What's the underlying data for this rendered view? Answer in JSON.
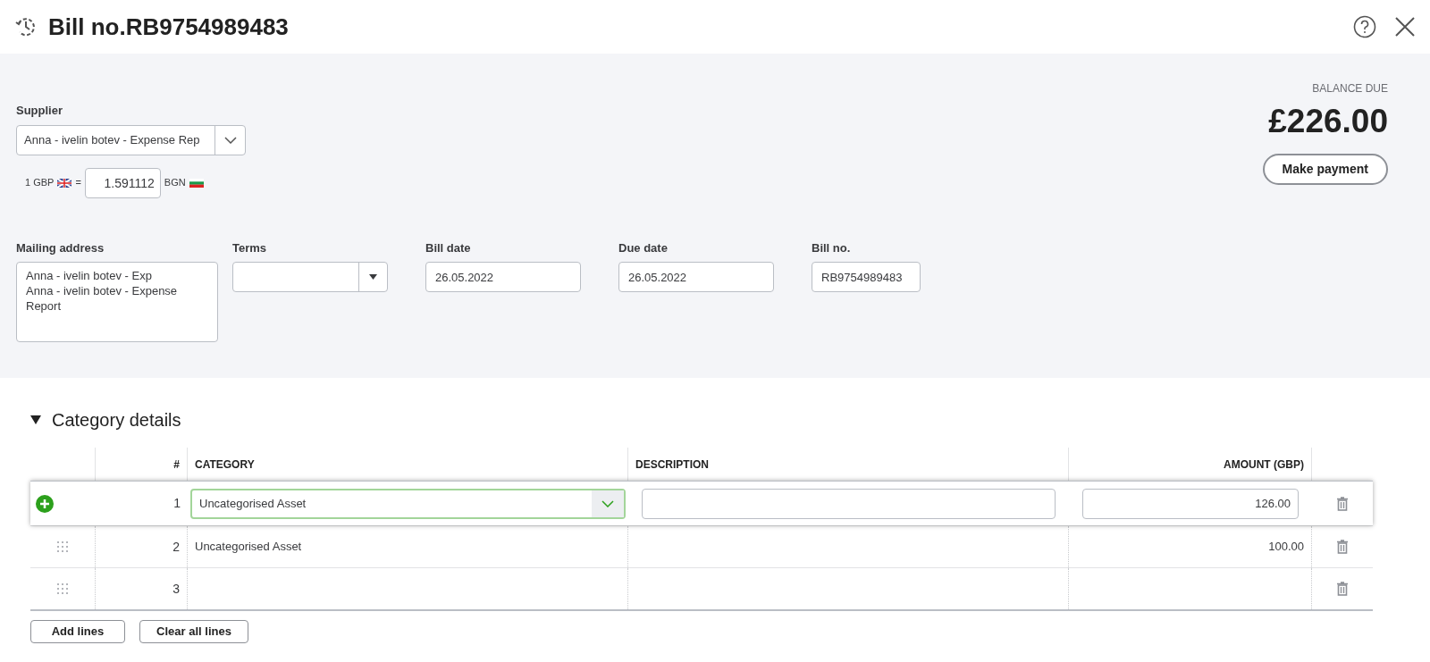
{
  "header": {
    "title": "Bill no.RB9754989483"
  },
  "balance": {
    "label": "BALANCE DUE",
    "amount": "£226.00",
    "button": "Make payment"
  },
  "supplier": {
    "label": "Supplier",
    "value": "Anna - ivelin botev - Expense Rep"
  },
  "exchange": {
    "base": "1 GBP",
    "equals": "=",
    "rate": "1.591112",
    "quote": "BGN"
  },
  "fields": [
    {
      "kind": "textarea",
      "label": "Mailing address",
      "value": "Anna - ivelin botev - Exp\nAnna - ivelin botev - Expense Report"
    },
    {
      "kind": "select",
      "label": "Terms"
    },
    {
      "kind": "text",
      "label": "Bill date",
      "value": "26.05.2022"
    },
    {
      "kind": "text",
      "label": "Due date",
      "value": "26.05.2022"
    },
    {
      "kind": "text",
      "label": "Bill no.",
      "value": "RB9754989483"
    }
  ],
  "category_section": {
    "title": "Category details",
    "expanded": true,
    "columns": [
      "#",
      "CATEGORY",
      "DESCRIPTION",
      "AMOUNT (GBP)"
    ],
    "rows": [
      {
        "kind": "editing",
        "number": "1",
        "category": "Uncategorised Asset",
        "amount": "126.00"
      },
      {
        "kind": "plain",
        "number": "2",
        "category": "Uncategorised Asset",
        "amount": "100.00"
      },
      {
        "kind": "plain",
        "number": "3"
      }
    ],
    "buttons": [
      "Add lines",
      "Clear all lines"
    ]
  }
}
